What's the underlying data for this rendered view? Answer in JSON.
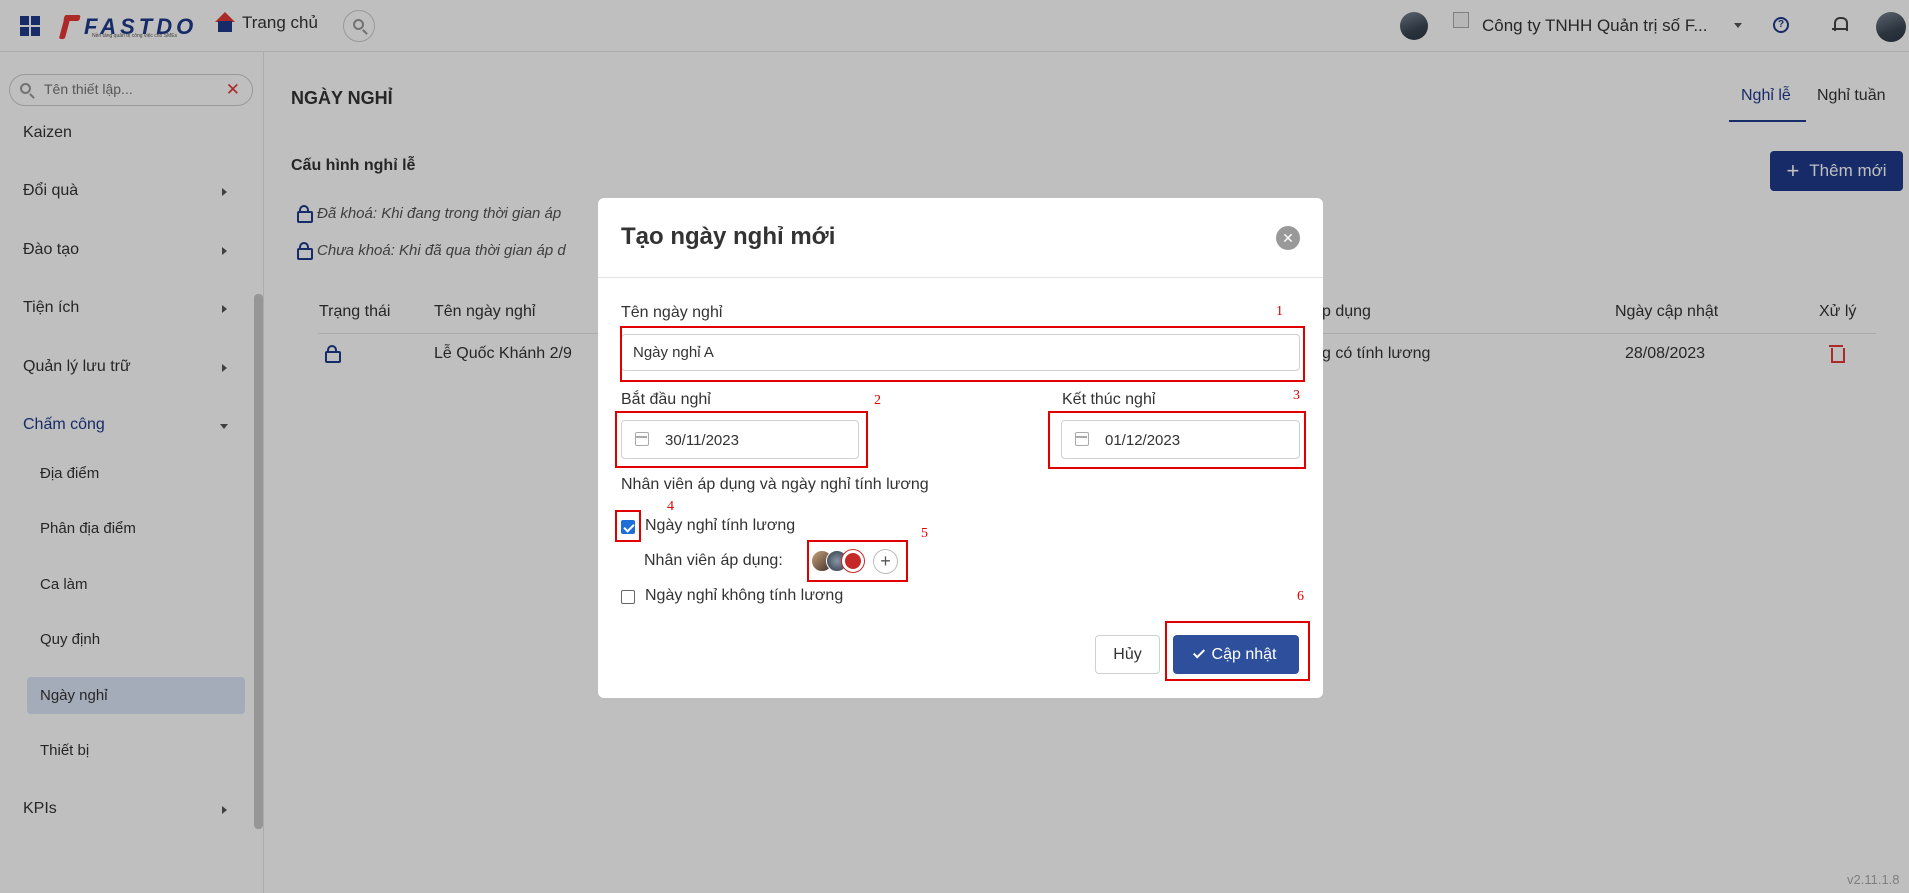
{
  "topbar": {
    "logo_text": "FASTDO",
    "logo_subtitle": "Nền tảng quản trị công việc cho SMEs",
    "home_label": "Trang chủ",
    "company_name": "Công ty TNHH Quản trị số F..."
  },
  "sidebar": {
    "search_placeholder": "Tên thiết lập...",
    "items": [
      {
        "label": "Kaizen"
      },
      {
        "label": "Đổi quà"
      },
      {
        "label": "Đào tạo"
      },
      {
        "label": "Tiện ích"
      },
      {
        "label": "Quản lý lưu trữ"
      },
      {
        "label": "Chấm công"
      },
      {
        "label": "KPIs"
      }
    ],
    "subitems": [
      {
        "label": "Địa điểm"
      },
      {
        "label": "Phân địa điểm"
      },
      {
        "label": "Ca làm"
      },
      {
        "label": "Quy định"
      },
      {
        "label": "Ngày nghỉ"
      },
      {
        "label": "Thiết bị"
      }
    ],
    "active_item": "Chấm công",
    "active_subitem": "Ngày nghỉ"
  },
  "page": {
    "title": "NGÀY NGHỈ",
    "tabs": [
      {
        "label": "Nghỉ lễ",
        "active": true
      },
      {
        "label": "Nghỉ tuần",
        "active": false
      }
    ],
    "section_title": "Cấu hình nghỉ lễ",
    "add_button": "Thêm mới",
    "notes": [
      "Đã khoá: Khi đang trong thời gian áp",
      "Chưa khoá: Khi đã qua thời gian áp d"
    ],
    "table": {
      "headers": [
        "Trạng thái",
        "Tên ngày nghỉ",
        "p dụng",
        "Ngày cập nhật",
        "Xử lý"
      ],
      "rows": [
        {
          "name": "Lễ Quốc Khánh 2/9",
          "apply": "g có tính lương",
          "updated": "28/08/2023"
        }
      ]
    },
    "version": "v2.11.1.8"
  },
  "modal": {
    "title": "Tạo ngày nghỉ mới",
    "name_label": "Tên ngày nghỉ",
    "name_value": "Ngày nghỉ A",
    "start_label": "Bắt đầu nghỉ",
    "start_value": "30/11/2023",
    "end_label": "Kết thúc nghỉ",
    "end_value": "01/12/2023",
    "group_label": "Nhân viên áp dụng và ngày nghỉ tính lương",
    "paid_label": "Ngày nghỉ tính lương",
    "paid_checked": true,
    "employees_label": "Nhân viên áp dụng:",
    "unpaid_label": "Ngày nghỉ không tính lương",
    "unpaid_checked": false,
    "cancel_label": "Hủy",
    "update_label": "Cập nhật"
  },
  "annotations": [
    "1",
    "2",
    "3",
    "4",
    "5",
    "6"
  ],
  "colors": {
    "primary": "#1e3a8a",
    "button": "#2e4f9c",
    "danger": "#e53935",
    "annotation": "#e00000",
    "active_bg": "#dbe4f7"
  }
}
